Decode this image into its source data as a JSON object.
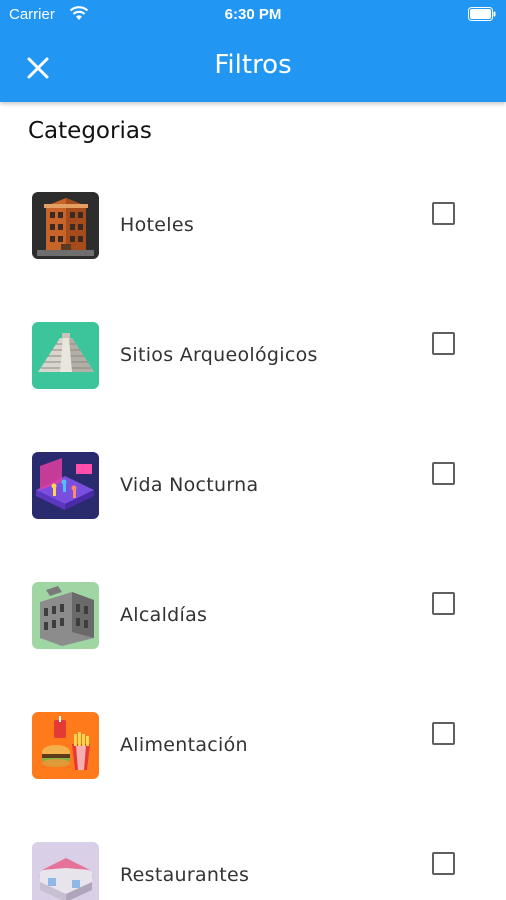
{
  "status_bar": {
    "carrier": "Carrier",
    "time": "6:30 PM"
  },
  "header": {
    "title": "Filtros",
    "close_icon": "close-icon"
  },
  "section": {
    "title": "Categorias"
  },
  "categories": [
    {
      "label": "Hoteles",
      "icon": "hotel-building-icon",
      "checked": false
    },
    {
      "label": "Sitios Arqueológicos",
      "icon": "pyramid-icon",
      "checked": false
    },
    {
      "label": "Vida Nocturna",
      "icon": "nightclub-icon",
      "checked": false
    },
    {
      "label": "Alcaldías",
      "icon": "city-hall-icon",
      "checked": false
    },
    {
      "label": "Alimentación",
      "icon": "fast-food-icon",
      "checked": false
    },
    {
      "label": "Restaurantes",
      "icon": "restaurant-icon",
      "checked": false
    }
  ],
  "colors": {
    "app_bar": "#2196f3",
    "checkbox_border": "#5f5f5f"
  }
}
